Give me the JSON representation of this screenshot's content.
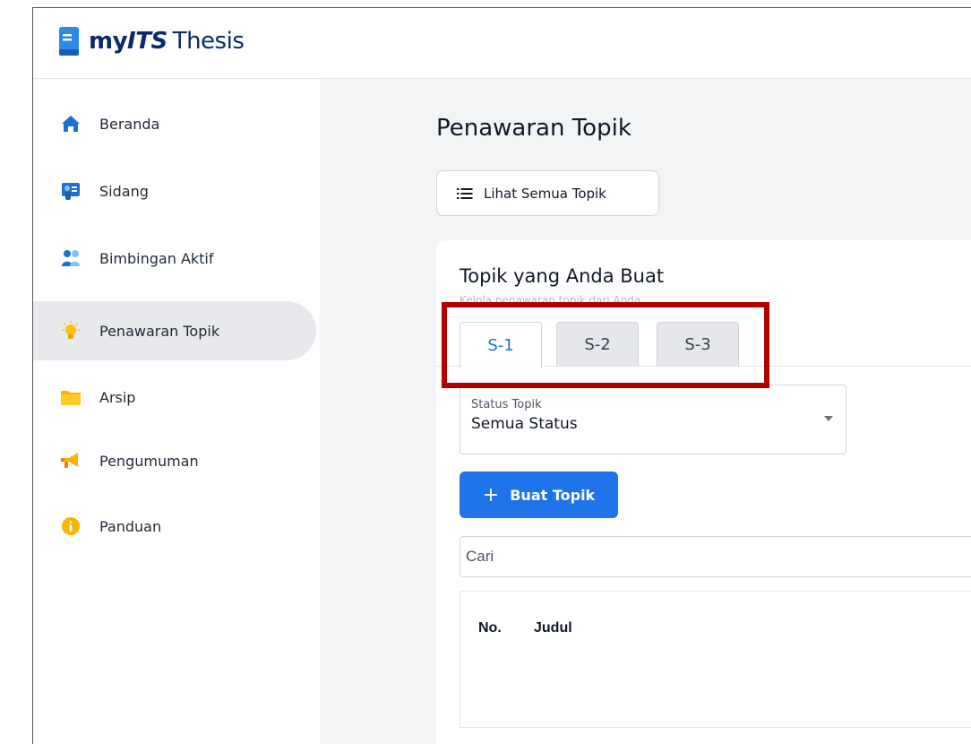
{
  "app": {
    "brand_prefix": "my",
    "brand_its": "ITS",
    "brand_suffix": "Thesis"
  },
  "sidebar": {
    "items": [
      {
        "label": "Beranda",
        "icon": "home-icon",
        "active": false
      },
      {
        "label": "Sidang",
        "icon": "presentation-icon",
        "active": false
      },
      {
        "label": "Bimbingan Aktif",
        "icon": "users-icon",
        "active": false
      },
      {
        "label": "Penawaran Topik",
        "icon": "lightbulb-icon",
        "active": true
      },
      {
        "label": "Arsip",
        "icon": "folder-icon",
        "active": false
      },
      {
        "label": "Pengumuman",
        "icon": "megaphone-icon",
        "active": false
      },
      {
        "label": "Panduan",
        "icon": "info-icon",
        "active": false
      }
    ]
  },
  "main": {
    "page_title": "Penawaran Topik",
    "view_all_button": "Lihat Semua Topik",
    "card": {
      "title": "Topik yang Anda Buat",
      "subtitle": "Kelola penawaran topik dari Anda",
      "tabs": [
        {
          "label": "S-1",
          "active": true
        },
        {
          "label": "S-2",
          "active": false
        },
        {
          "label": "S-3",
          "active": false
        }
      ],
      "status_select": {
        "label": "Status Topik",
        "value": "Semua Status"
      },
      "create_button": "Buat Topik",
      "search_placeholder": "Cari",
      "table_headers": [
        "No.",
        "Judul"
      ]
    }
  },
  "colors": {
    "primary": "#1e74e8",
    "brand_navy": "#0b2a6b",
    "highlight": "#b00000",
    "active_tab_text": "#1e6fd9"
  }
}
